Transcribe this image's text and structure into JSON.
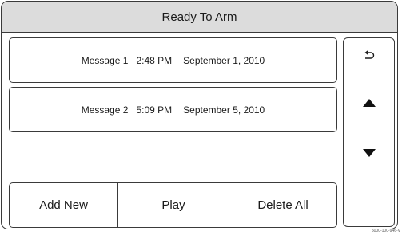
{
  "title": "Ready To Arm",
  "messages": [
    {
      "label": "Message 1",
      "time": "2:48 PM",
      "date": "September 1, 2010"
    },
    {
      "label": "Message 2",
      "time": "5:09 PM",
      "date": "September 5, 2010"
    }
  ],
  "buttons": {
    "add_new": "Add New",
    "play": "Play",
    "delete_all": "Delete All"
  },
  "side_controls": {
    "back_icon": "return-arrow-icon",
    "up_icon": "triangle-up-icon",
    "down_icon": "triangle-down-icon"
  },
  "doc_id": "5000-100-946-V"
}
